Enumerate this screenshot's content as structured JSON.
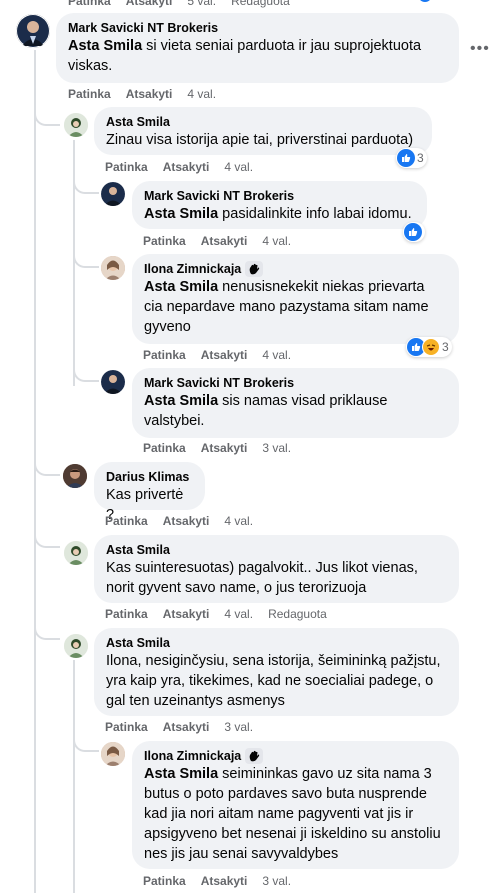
{
  "top_partial": {
    "like": "Patinka",
    "reply": "Atsakyti",
    "time": "5 val.",
    "edited": "Redaguota"
  },
  "comments": [
    {
      "author": "Mark Savicki NT Brokeris",
      "mention": "Asta Smila",
      "text": " si vieta seniai parduota ir jau suprojektuota viskas.",
      "like": "Patinka",
      "reply": "Atsakyti",
      "time": "4 val."
    },
    {
      "author": "Asta Smila",
      "text": "Zinau visa istorija apie tai, priverstinai parduota)",
      "like": "Patinka",
      "reply": "Atsakyti",
      "time": "4 val.",
      "reactions": "3"
    },
    {
      "author": "Mark Savicki NT Brokeris",
      "mention": "Asta Smila",
      "text": " pasidalinkite info labai idomu.",
      "like": "Patinka",
      "reply": "Atsakyti",
      "time": "4 val."
    },
    {
      "author": "Ilona Zimnickaja",
      "mention": "Asta Smila",
      "text": " nenusisnekekit niekas prievarta cia nepardave mano pazystama sitam name gyveno",
      "like": "Patinka",
      "reply": "Atsakyti",
      "time": "4 val.",
      "reactions": "3"
    },
    {
      "author": "Mark Savicki NT Brokeris",
      "mention": "Asta Smila",
      "text": " sis namas visad priklause valstybei.",
      "like": "Patinka",
      "reply": "Atsakyti",
      "time": "3 val."
    },
    {
      "author": "Darius Klimas",
      "text": "Kas privertė ?",
      "like": "Patinka",
      "reply": "Atsakyti",
      "time": "4 val."
    },
    {
      "author": "Asta Smila",
      "text": "Kas suinteresuotas) pagalvokit.. Jus likot vienas, norit gyvent savo name, o jus terorizuoja",
      "like": "Patinka",
      "reply": "Atsakyti",
      "time": "4 val.",
      "edited": "Redaguota"
    },
    {
      "author": "Asta Smila",
      "text": "Ilona, nesiginčysiu, sena istorija, šeimininką pažįstu, yra kaip yra, tikekimes, kad ne soecialiai padege, o gal ten uzeinantys asmenys",
      "like": "Patinka",
      "reply": "Atsakyti",
      "time": "3 val."
    },
    {
      "author": "Ilona Zimnickaja",
      "mention": "Asta Smila",
      "text": " seimininkas gavo uz sita nama 3 butus o poto pardaves savo buta nusprende kad jia nori aitam name pagyventi vat jis ir apsigyveno bet nesenai ji iskeldino su anstoliu nes jis jau senai savyvaldybes",
      "like": "Patinka",
      "reply": "Atsakyti",
      "time": "3 val."
    }
  ],
  "colors": {
    "bubble": "#f0f2f5",
    "meta": "#65676b",
    "like_blue": "#1877f2",
    "haha_yellow": "#f7b125"
  },
  "icons": {
    "more": "more-horizontal-icon",
    "wave": "hand-wave-icon",
    "like": "like-reaction-icon",
    "haha": "haha-reaction-icon"
  }
}
